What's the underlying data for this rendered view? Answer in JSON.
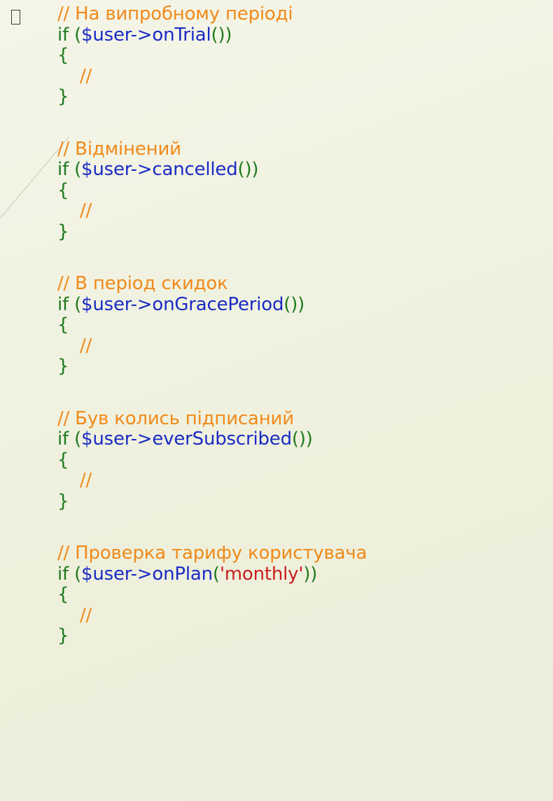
{
  "blocks": [
    {
      "comment": "// На випробному періоді",
      "var": "$user->onTrial",
      "args": "",
      "body_comment": "//"
    },
    {
      "comment": "// Відмінений",
      "var": "$user->cancelled",
      "args": "",
      "body_comment": "//"
    },
    {
      "comment": "// В період скидок",
      "var": "$user->onGracePeriod",
      "args": "",
      "body_comment": "//"
    },
    {
      "comment": "// Був колись підписаний",
      "var": "$user->everSubscribed",
      "args": "",
      "body_comment": "//"
    },
    {
      "comment": "// Проверка тарифу користувача",
      "var": "$user->onPlan",
      "args": "'monthly'",
      "body_comment": "//"
    }
  ],
  "syntax": {
    "if_keyword": "if",
    "open_paren": "(",
    "close_parens": "())",
    "open_call_paren": "(",
    "close_call_parens": "))",
    "open_brace": "{",
    "close_brace": "}"
  },
  "colors": {
    "background": "#f2f3e4",
    "comment": "#f08a1a",
    "keyword": "#1f7a1f",
    "variable": "#1a2bc4",
    "string": "#c81e1e"
  },
  "icons": {
    "bullet": "square-bullet-icon"
  }
}
